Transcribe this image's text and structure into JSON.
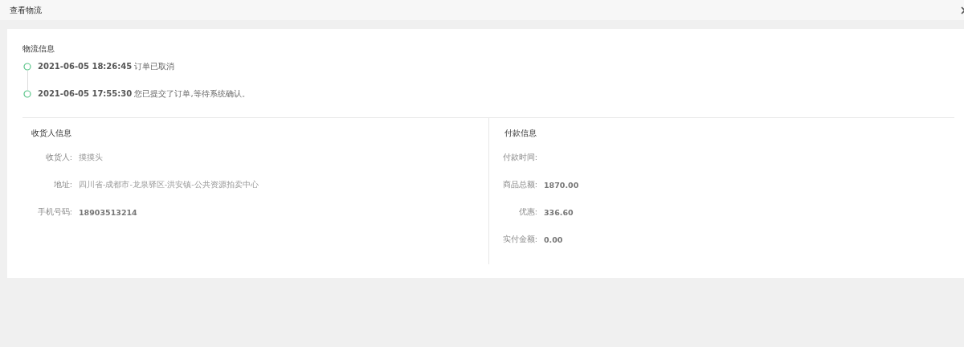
{
  "window": {
    "title": "查看物流"
  },
  "logistics": {
    "title": "物流信息",
    "events": [
      {
        "time": "2021-06-05 18:26:45",
        "text": "订单已取消"
      },
      {
        "time": "2021-06-05 17:55:30",
        "text": "您已提交了订单,等待系统确认。"
      }
    ]
  },
  "sections": [
    {
      "title": "收货人信息",
      "fields": [
        {
          "label": "收货人:",
          "value": "摸摸头",
          "kind": "text"
        },
        {
          "label": "地址:",
          "value": "四川省-成都市-龙泉驿区-洪安镇-公共资源拍卖中心",
          "kind": "text"
        },
        {
          "label": "手机号码:",
          "value": "18903513214",
          "kind": "number"
        }
      ]
    },
    {
      "title": "付款信息",
      "fields": [
        {
          "label": "付款时间:"
        },
        {
          "label": "商品总额:",
          "value": "1870.00",
          "kind": "number"
        },
        {
          "label": "优惠:",
          "value": "336.60",
          "kind": "number"
        },
        {
          "label": "实付金额:",
          "value": "0.00",
          "kind": "number"
        }
      ]
    }
  ]
}
